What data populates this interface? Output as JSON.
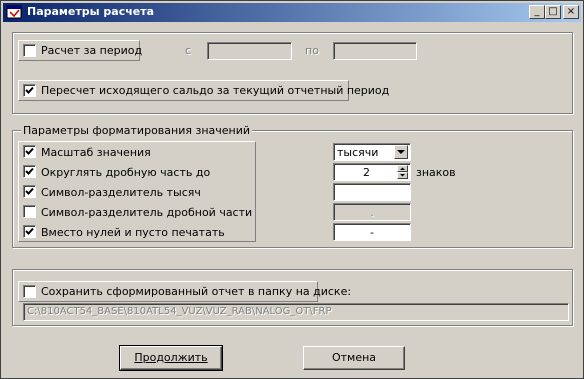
{
  "window": {
    "title": "Параметры расчета",
    "minimize_glyph": "_",
    "maximize_glyph": "□",
    "close_glyph": "×"
  },
  "period": {
    "checkbox_label": "Расчет за период",
    "checked": false,
    "from_label": "с",
    "to_label": "по",
    "from_value": "",
    "to_value": ""
  },
  "recalc": {
    "checkbox_label": "Пересчет исходящего сальдо за текущий отчетный период",
    "checked": true
  },
  "formatting": {
    "group_title": "Параметры форматирования значений",
    "scale": {
      "label": "Масштаб значения",
      "checked": true,
      "value": "тысячи"
    },
    "round": {
      "label": "Округлять дробную часть до",
      "checked": true,
      "value": "2",
      "suffix": "знаков"
    },
    "thousand_sep": {
      "label": "Символ-разделитель тысяч",
      "checked": true,
      "value": ""
    },
    "decimal_sep": {
      "label": "Символ-разделитель дробной части",
      "checked": false,
      "value": "."
    },
    "zero": {
      "label": "Вместо нулей и пусто печатать",
      "checked": true,
      "value": "-"
    }
  },
  "save": {
    "checkbox_label": "Сохранить сформированный отчет в папку на диске:",
    "checked": false,
    "path": "C:\\810ACT54_BASE\\810ATL54_VUZ\\VUZ_RAB\\NALOG_OT\\FRP"
  },
  "buttons": {
    "continue_label": "Продолжить",
    "cancel_label": "Отмена"
  },
  "colors": {
    "face": "#d4d0c8",
    "title_start": "#0a246a",
    "title_end": "#a6caf0"
  },
  "icons": {
    "app": "window-icon",
    "check": "checkmark-icon",
    "dropdown": "dropdown-arrow-icon",
    "spin_up": "spin-up-icon",
    "spin_down": "spin-down-icon"
  }
}
